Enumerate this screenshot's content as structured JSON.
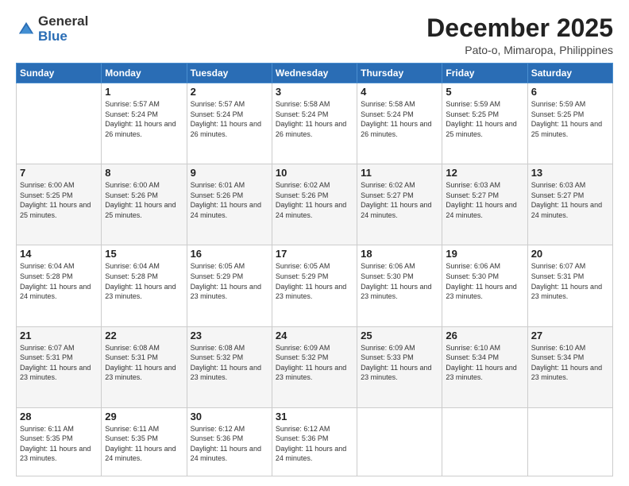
{
  "logo": {
    "general": "General",
    "blue": "Blue"
  },
  "header": {
    "month": "December 2025",
    "location": "Pato-o, Mimaropa, Philippines"
  },
  "weekdays": [
    "Sunday",
    "Monday",
    "Tuesday",
    "Wednesday",
    "Thursday",
    "Friday",
    "Saturday"
  ],
  "weeks": [
    [
      {
        "day": "",
        "sunrise": "",
        "sunset": "",
        "daylight": ""
      },
      {
        "day": "1",
        "sunrise": "Sunrise: 5:57 AM",
        "sunset": "Sunset: 5:24 PM",
        "daylight": "Daylight: 11 hours and 26 minutes."
      },
      {
        "day": "2",
        "sunrise": "Sunrise: 5:57 AM",
        "sunset": "Sunset: 5:24 PM",
        "daylight": "Daylight: 11 hours and 26 minutes."
      },
      {
        "day": "3",
        "sunrise": "Sunrise: 5:58 AM",
        "sunset": "Sunset: 5:24 PM",
        "daylight": "Daylight: 11 hours and 26 minutes."
      },
      {
        "day": "4",
        "sunrise": "Sunrise: 5:58 AM",
        "sunset": "Sunset: 5:24 PM",
        "daylight": "Daylight: 11 hours and 26 minutes."
      },
      {
        "day": "5",
        "sunrise": "Sunrise: 5:59 AM",
        "sunset": "Sunset: 5:25 PM",
        "daylight": "Daylight: 11 hours and 25 minutes."
      },
      {
        "day": "6",
        "sunrise": "Sunrise: 5:59 AM",
        "sunset": "Sunset: 5:25 PM",
        "daylight": "Daylight: 11 hours and 25 minutes."
      }
    ],
    [
      {
        "day": "7",
        "sunrise": "Sunrise: 6:00 AM",
        "sunset": "Sunset: 5:25 PM",
        "daylight": "Daylight: 11 hours and 25 minutes."
      },
      {
        "day": "8",
        "sunrise": "Sunrise: 6:00 AM",
        "sunset": "Sunset: 5:26 PM",
        "daylight": "Daylight: 11 hours and 25 minutes."
      },
      {
        "day": "9",
        "sunrise": "Sunrise: 6:01 AM",
        "sunset": "Sunset: 5:26 PM",
        "daylight": "Daylight: 11 hours and 24 minutes."
      },
      {
        "day": "10",
        "sunrise": "Sunrise: 6:02 AM",
        "sunset": "Sunset: 5:26 PM",
        "daylight": "Daylight: 11 hours and 24 minutes."
      },
      {
        "day": "11",
        "sunrise": "Sunrise: 6:02 AM",
        "sunset": "Sunset: 5:27 PM",
        "daylight": "Daylight: 11 hours and 24 minutes."
      },
      {
        "day": "12",
        "sunrise": "Sunrise: 6:03 AM",
        "sunset": "Sunset: 5:27 PM",
        "daylight": "Daylight: 11 hours and 24 minutes."
      },
      {
        "day": "13",
        "sunrise": "Sunrise: 6:03 AM",
        "sunset": "Sunset: 5:27 PM",
        "daylight": "Daylight: 11 hours and 24 minutes."
      }
    ],
    [
      {
        "day": "14",
        "sunrise": "Sunrise: 6:04 AM",
        "sunset": "Sunset: 5:28 PM",
        "daylight": "Daylight: 11 hours and 24 minutes."
      },
      {
        "day": "15",
        "sunrise": "Sunrise: 6:04 AM",
        "sunset": "Sunset: 5:28 PM",
        "daylight": "Daylight: 11 hours and 23 minutes."
      },
      {
        "day": "16",
        "sunrise": "Sunrise: 6:05 AM",
        "sunset": "Sunset: 5:29 PM",
        "daylight": "Daylight: 11 hours and 23 minutes."
      },
      {
        "day": "17",
        "sunrise": "Sunrise: 6:05 AM",
        "sunset": "Sunset: 5:29 PM",
        "daylight": "Daylight: 11 hours and 23 minutes."
      },
      {
        "day": "18",
        "sunrise": "Sunrise: 6:06 AM",
        "sunset": "Sunset: 5:30 PM",
        "daylight": "Daylight: 11 hours and 23 minutes."
      },
      {
        "day": "19",
        "sunrise": "Sunrise: 6:06 AM",
        "sunset": "Sunset: 5:30 PM",
        "daylight": "Daylight: 11 hours and 23 minutes."
      },
      {
        "day": "20",
        "sunrise": "Sunrise: 6:07 AM",
        "sunset": "Sunset: 5:31 PM",
        "daylight": "Daylight: 11 hours and 23 minutes."
      }
    ],
    [
      {
        "day": "21",
        "sunrise": "Sunrise: 6:07 AM",
        "sunset": "Sunset: 5:31 PM",
        "daylight": "Daylight: 11 hours and 23 minutes."
      },
      {
        "day": "22",
        "sunrise": "Sunrise: 6:08 AM",
        "sunset": "Sunset: 5:31 PM",
        "daylight": "Daylight: 11 hours and 23 minutes."
      },
      {
        "day": "23",
        "sunrise": "Sunrise: 6:08 AM",
        "sunset": "Sunset: 5:32 PM",
        "daylight": "Daylight: 11 hours and 23 minutes."
      },
      {
        "day": "24",
        "sunrise": "Sunrise: 6:09 AM",
        "sunset": "Sunset: 5:32 PM",
        "daylight": "Daylight: 11 hours and 23 minutes."
      },
      {
        "day": "25",
        "sunrise": "Sunrise: 6:09 AM",
        "sunset": "Sunset: 5:33 PM",
        "daylight": "Daylight: 11 hours and 23 minutes."
      },
      {
        "day": "26",
        "sunrise": "Sunrise: 6:10 AM",
        "sunset": "Sunset: 5:34 PM",
        "daylight": "Daylight: 11 hours and 23 minutes."
      },
      {
        "day": "27",
        "sunrise": "Sunrise: 6:10 AM",
        "sunset": "Sunset: 5:34 PM",
        "daylight": "Daylight: 11 hours and 23 minutes."
      }
    ],
    [
      {
        "day": "28",
        "sunrise": "Sunrise: 6:11 AM",
        "sunset": "Sunset: 5:35 PM",
        "daylight": "Daylight: 11 hours and 23 minutes."
      },
      {
        "day": "29",
        "sunrise": "Sunrise: 6:11 AM",
        "sunset": "Sunset: 5:35 PM",
        "daylight": "Daylight: 11 hours and 24 minutes."
      },
      {
        "day": "30",
        "sunrise": "Sunrise: 6:12 AM",
        "sunset": "Sunset: 5:36 PM",
        "daylight": "Daylight: 11 hours and 24 minutes."
      },
      {
        "day": "31",
        "sunrise": "Sunrise: 6:12 AM",
        "sunset": "Sunset: 5:36 PM",
        "daylight": "Daylight: 11 hours and 24 minutes."
      },
      {
        "day": "",
        "sunrise": "",
        "sunset": "",
        "daylight": ""
      },
      {
        "day": "",
        "sunrise": "",
        "sunset": "",
        "daylight": ""
      },
      {
        "day": "",
        "sunrise": "",
        "sunset": "",
        "daylight": ""
      }
    ]
  ]
}
